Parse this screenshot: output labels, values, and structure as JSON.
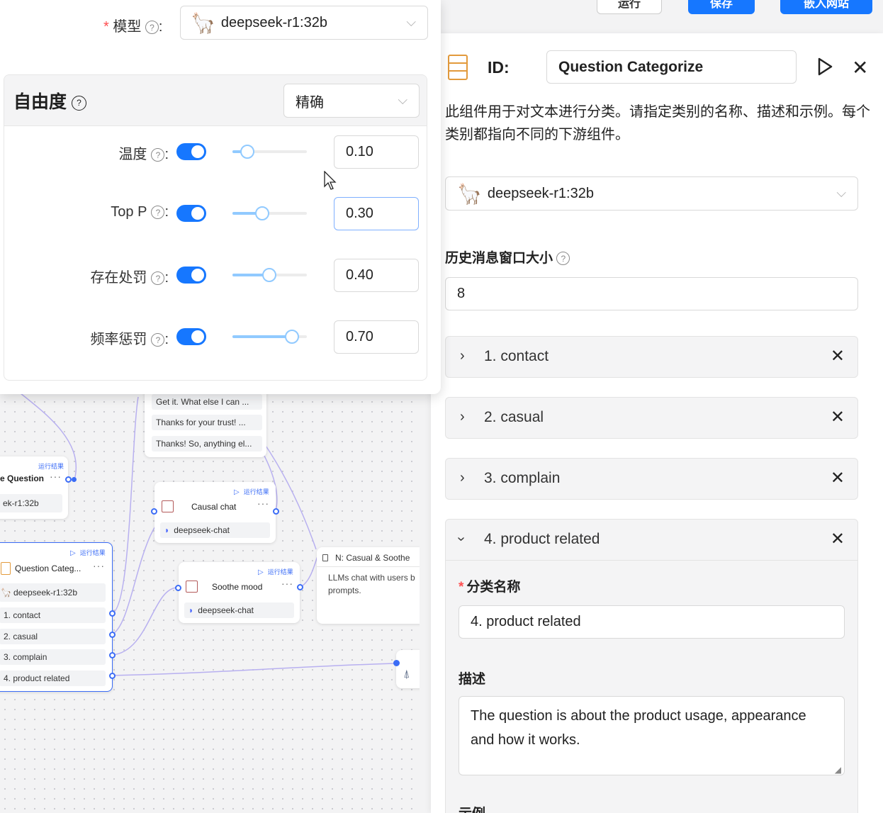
{
  "toolbar": {
    "run_label": "运行",
    "save_label": "保存",
    "embed_label": "嵌入网站"
  },
  "canvas": {
    "msg_rows": [
      "Get it. What else I can ...",
      "Thanks for your trust! ...",
      "Thanks! So, anything el..."
    ],
    "question_node_partial": {
      "title": "e Question",
      "model": "ek-r1:32b",
      "run_label": "运行结果"
    },
    "causal_node": {
      "title": "Causal chat",
      "model": "deepseek-chat",
      "run_label": "运行结果"
    },
    "soothe_node": {
      "title": "Soothe mood",
      "model": "deepseek-chat",
      "run_label": "运行结果"
    },
    "categorize_node": {
      "title": "Question Categ...",
      "model": "deepseek-r1:32b",
      "run_label": "运行结果",
      "items": [
        "1. contact",
        "2. casual",
        "3. complain",
        "4. product related"
      ]
    },
    "note_node": {
      "title": "N: Casual & Soothe",
      "body": "LLMs chat with users b prompts."
    }
  },
  "popup": {
    "model_label": "模型",
    "model_value": "deepseek-r1:32b",
    "freedom_title": "自由度",
    "freedom_mode": "精确",
    "params": [
      {
        "label": "温度",
        "value": "0.10",
        "level": 0.1
      },
      {
        "label": "Top P",
        "value": "0.30",
        "level": 0.3
      },
      {
        "label": "存在处罚",
        "value": "0.40",
        "level": 0.4
      },
      {
        "label": "频率惩罚",
        "value": "0.70",
        "level": 0.7
      }
    ]
  },
  "panel": {
    "id_label": "ID:",
    "id_value": "Question Categorize",
    "description": "此组件用于对文本进行分类。请指定类别的名称、描述和示例。每个类别都指向不同的下游组件。",
    "model_value": "deepseek-r1:32b",
    "history_label": "历史消息窗口大小",
    "history_value": "8",
    "categories": [
      "1. contact",
      "2. casual",
      "3. complain"
    ],
    "expanded_category": {
      "header": "4. product related",
      "name_label": "分类名称",
      "name_value": "4. product related",
      "desc_label": "描述",
      "desc_value": "The question is about the product usage, appearance and how it works.",
      "examples_label": "示例"
    }
  }
}
